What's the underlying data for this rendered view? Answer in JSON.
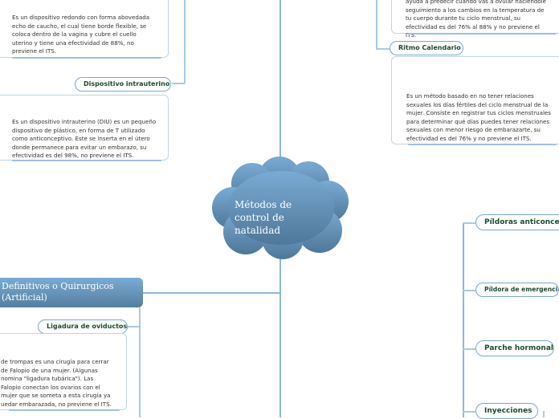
{
  "central_topic": {
    "lines": [
      "Métodos de",
      "control de",
      "natalidad"
    ]
  },
  "left_top": {
    "diafragma_description": "Es un dispositivo redondo con forma abovedada echo de caucho, el cual tiene borde flexible, se coloca dentro de la vagina y cubre el cuello uterino y tiene una efectividad de 88%, no previene el ITS.",
    "diu_label": "Dispositivo intrauterino",
    "diu_description": "Es un dispositivo intrauterino (DIU) es un pequeño dispositivo de plástico, en forma de T utilizado como anticonceptivo. Este se inserta en el útero donde permanece para evitar un embarazo, su efectividad es del 98%, no previene el ITS."
  },
  "right_top": {
    "temperatura_description": "ayuda a predecir cuándo vas a ovular haciéndole seguimiento a los cambios en la temperatura de tu cuerpo durante tu ciclo menstrual, su efectividad es del 76% al 88% y no previene el ITS.",
    "ritmo_label": "Ritmo Calendario",
    "ritmo_description": "Es un método basado en no tener relaciones sexuales los días fértiles del ciclo menstrual de la mujer. Consiste en registrar tus ciclos menstruales para determinar qué días puedes tener relaciones sexuales con menor riesgo de embarazarte, su efectividad es del 76% y no previene el ITS."
  },
  "left_bottom": {
    "branch_label_lines": [
      "Definitivos o Quirurgicos",
      "(Artificial)"
    ],
    "ligadura_label": "Ligadura de oviductos",
    "ligadura_description_lines": [
      "de trompas es una cirugía para cerrar",
      "de Falopio de una mujer. (Algunas",
      "nomina \"ligadura tubárica\"). Las",
      "Falopio conectan los ovarios con el",
      "mujer que se someta a esta cirugía ya",
      "uedar embarazada, no previene el ITS."
    ]
  },
  "right_bottom": {
    "items": [
      "Píldoras anticonceptivas",
      "Píldora de emergencia",
      "Parche hormonal",
      "Inyecciones"
    ]
  },
  "colors": {
    "node_gradient_top": "#7aabd4",
    "node_gradient_bottom": "#547e9f",
    "connector": "#8fb7d9",
    "pill_text": "#1d4a2e"
  }
}
